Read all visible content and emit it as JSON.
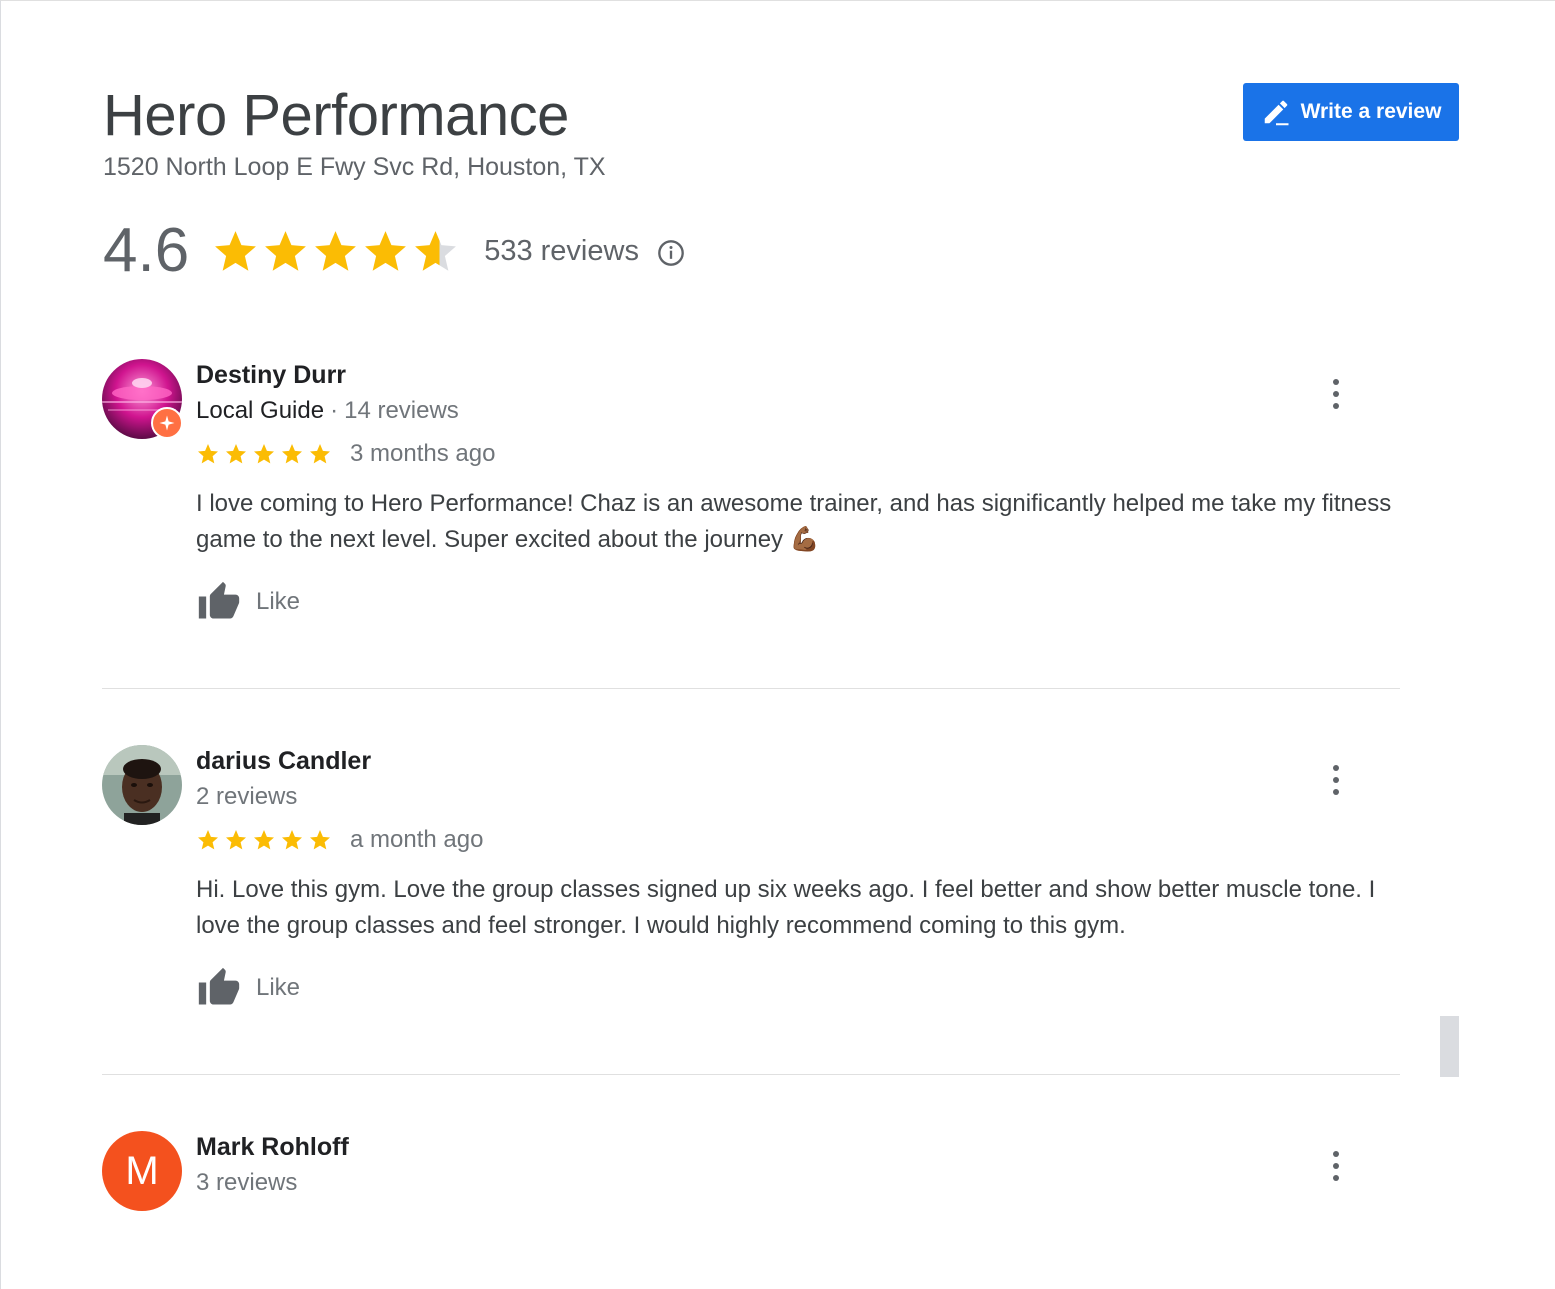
{
  "header": {
    "name": "Hero Performance",
    "address": "1520 North Loop E Fwy Svc Rd, Houston, TX",
    "write_review_label": "Write a review"
  },
  "summary": {
    "rating": "4.6",
    "rating_value": 4.6,
    "review_count": "533 reviews",
    "star_color": "#fbbc04"
  },
  "reviews": [
    {
      "author": "Destiny Durr",
      "badge": "Local Guide",
      "count": "14 reviews",
      "stars": 5,
      "time": "3 months ago",
      "text": "I love coming to Hero Performance! Chaz is an awesome trainer, and has significantly helped me take my fitness game to the next level. Super excited about the journey 💪🏾",
      "like_label": "Like"
    },
    {
      "author": "darius Candler",
      "count": "2 reviews",
      "stars": 5,
      "time": "a month ago",
      "text": "Hi. Love this gym. Love the group classes signed up six weeks ago. I feel better and show better muscle tone. I love the group classes and feel stronger. I would highly recommend coming to this gym.",
      "like_label": "Like"
    },
    {
      "author": "Mark Rohloff",
      "initial": "M",
      "count": "3 reviews",
      "avatar_color": "#f4511e"
    }
  ],
  "colors": {
    "accent": "#1a73e8"
  }
}
